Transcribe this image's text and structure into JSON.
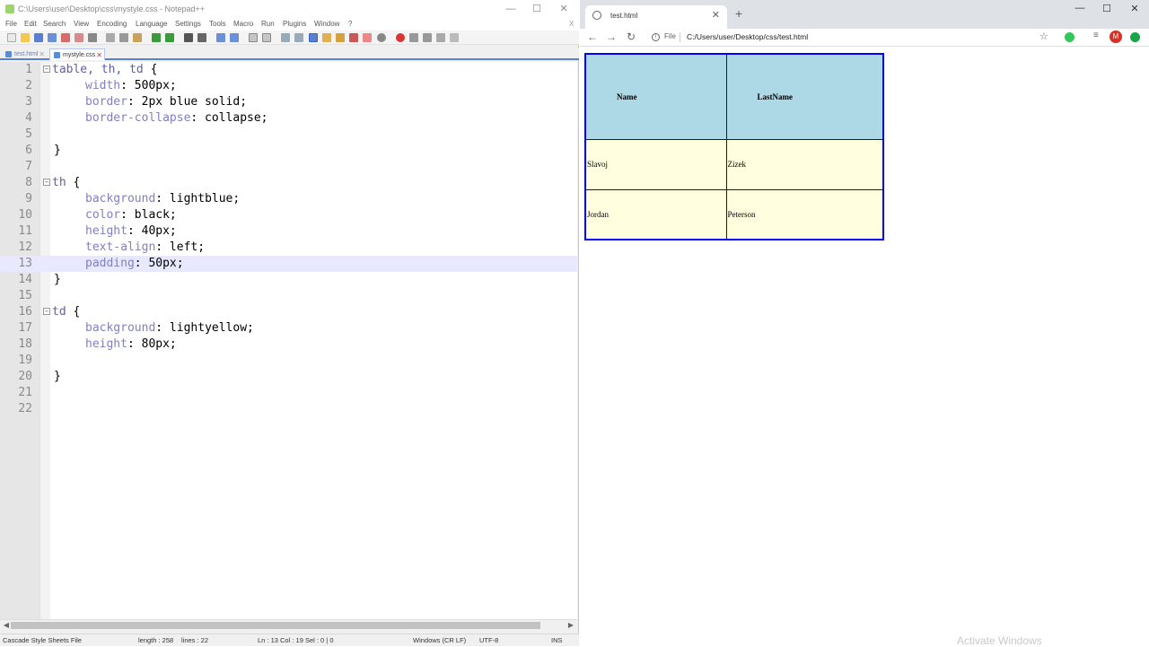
{
  "notepad": {
    "title": "C:\\Users\\user\\Desktop\\css\\mystyle.css - Notepad++",
    "window_buttons": [
      "—",
      "☐",
      "✕"
    ],
    "menu": [
      "File",
      "Edit",
      "Search",
      "View",
      "Encoding",
      "Language",
      "Settings",
      "Tools",
      "Macro",
      "Run",
      "Plugins",
      "Window",
      "?"
    ],
    "close_x": "X",
    "tabs": [
      {
        "label": "test.html",
        "active": false
      },
      {
        "label": "mystyle.css",
        "active": true
      }
    ],
    "tab_close": "✕",
    "fold_open": "−",
    "line_numbers": [
      "1",
      "2",
      "3",
      "4",
      "5",
      "6",
      "7",
      "8",
      "9",
      "10",
      "11",
      "12",
      "13",
      "14",
      "15",
      "16",
      "17",
      "18",
      "19",
      "20",
      "21",
      "22"
    ],
    "code": {
      "l1_sel": "table, th, td",
      "l1_brace": " {",
      "l2_prop": "width",
      "l2_val": ": 500px;",
      "l3_prop": "border",
      "l3_val": ": 2px blue solid;",
      "l4_prop": "border-collapse",
      "l4_val": ": collapse;",
      "l6": "}",
      "l8_sel": "th",
      "l8_brace": " {",
      "l9_prop": "background",
      "l9_val": ": lightblue;",
      "l10_prop": "color",
      "l10_val": ": black;",
      "l11_prop": "height",
      "l11_val": ": 40px;",
      "l12_prop": "text-align",
      "l12_val": ": left;",
      "l13_prop": "padding",
      "l13_val": ": 50px;",
      "l14": "}",
      "l16_sel": "td",
      "l16_brace": " {",
      "l17_prop": "background",
      "l17_val": ": lightyellow;",
      "l18_prop": "height",
      "l18_val": ": 80px;",
      "l20": "}"
    },
    "status": {
      "file_type": "Cascade Style Sheets File",
      "length": "length : 258",
      "lines": "lines : 22",
      "position": "Ln : 13    Col : 19    Sel : 0 | 0",
      "eol": "Windows (CR LF)",
      "encoding": "UTF-8",
      "mode": "INS"
    }
  },
  "chrome": {
    "tab_title": "test.html",
    "tab_close": "✕",
    "new_tab": "+",
    "window_buttons": [
      "—",
      "☐",
      "✕"
    ],
    "nav_back": "←",
    "nav_forward": "→",
    "nav_reload": "↻",
    "info": "i",
    "scheme": "File",
    "url": "C:/Users/user/Desktop/css/test.html",
    "star": "☆",
    "menu": "⋮",
    "avatar": "M",
    "ext_colors": [
      "#34c759",
      "#1aa34a"
    ],
    "table": {
      "headers": [
        "Name",
        "LastName"
      ],
      "rows": [
        [
          "Slavoj",
          "Zizek"
        ],
        [
          "Jordan",
          "Peterson"
        ]
      ]
    },
    "watermark": "Activate Windows"
  }
}
